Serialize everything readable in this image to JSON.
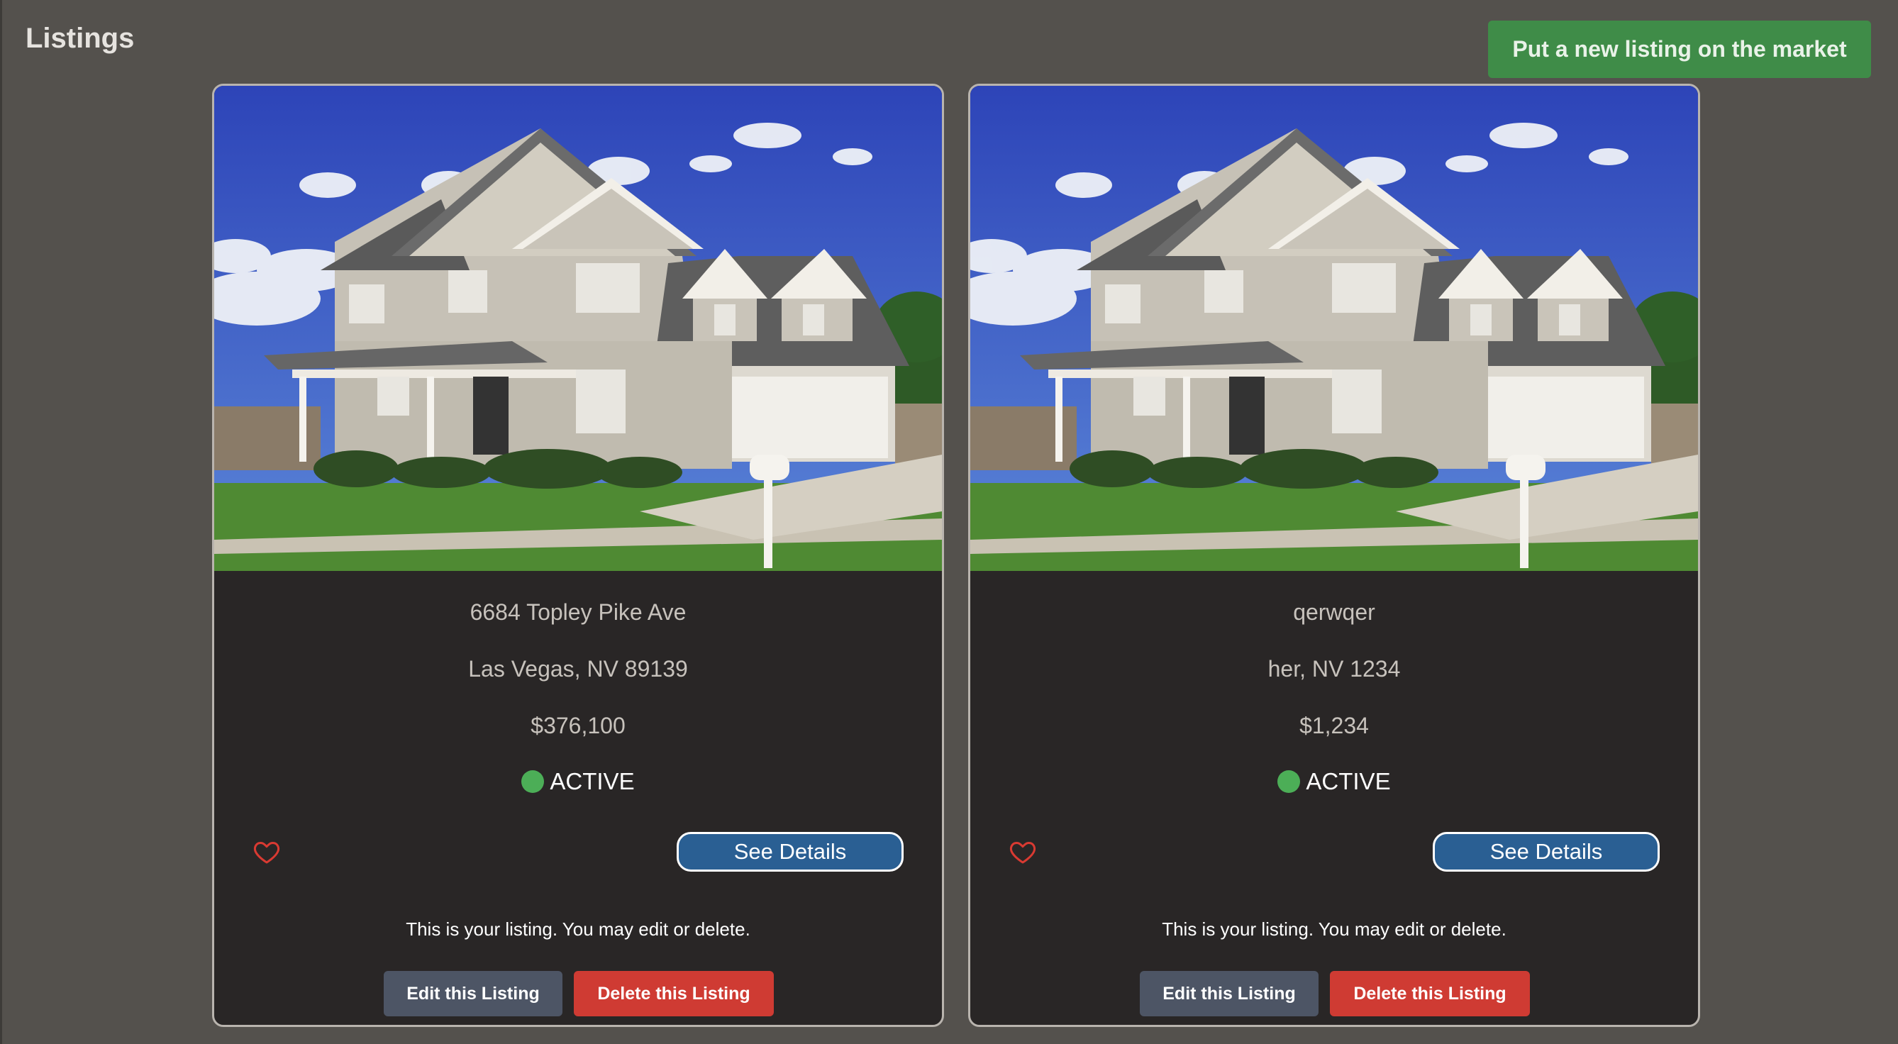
{
  "header": {
    "title": "Listings",
    "new_listing_label": "Put a new listing on the market"
  },
  "colors": {
    "background": "#54514d",
    "card_background": "#292626",
    "primary_green": "#3f8c48",
    "status_active": "#4cae57",
    "details_blue": "#2a5f93",
    "edit_gray": "#4d5565",
    "delete_red": "#cf3b33",
    "heart_red": "#d93a32"
  },
  "listings": [
    {
      "address": "6684 Topley Pike Ave",
      "city_state_zip": "Las Vegas, NV 89139",
      "price": "$376,100",
      "status": "ACTIVE",
      "favorite_icon": "heart-outline-icon",
      "details_label": "See Details",
      "owner_note": "This is your listing. You may edit or delete.",
      "edit_label": "Edit this Listing",
      "delete_label": "Delete this Listing"
    },
    {
      "address": "qerwqer",
      "city_state_zip": "her, NV 1234",
      "price": "$1,234",
      "status": "ACTIVE",
      "favorite_icon": "heart-outline-icon",
      "details_label": "See Details",
      "owner_note": "This is your listing. You may edit or delete.",
      "edit_label": "Edit this Listing",
      "delete_label": "Delete this Listing"
    }
  ]
}
